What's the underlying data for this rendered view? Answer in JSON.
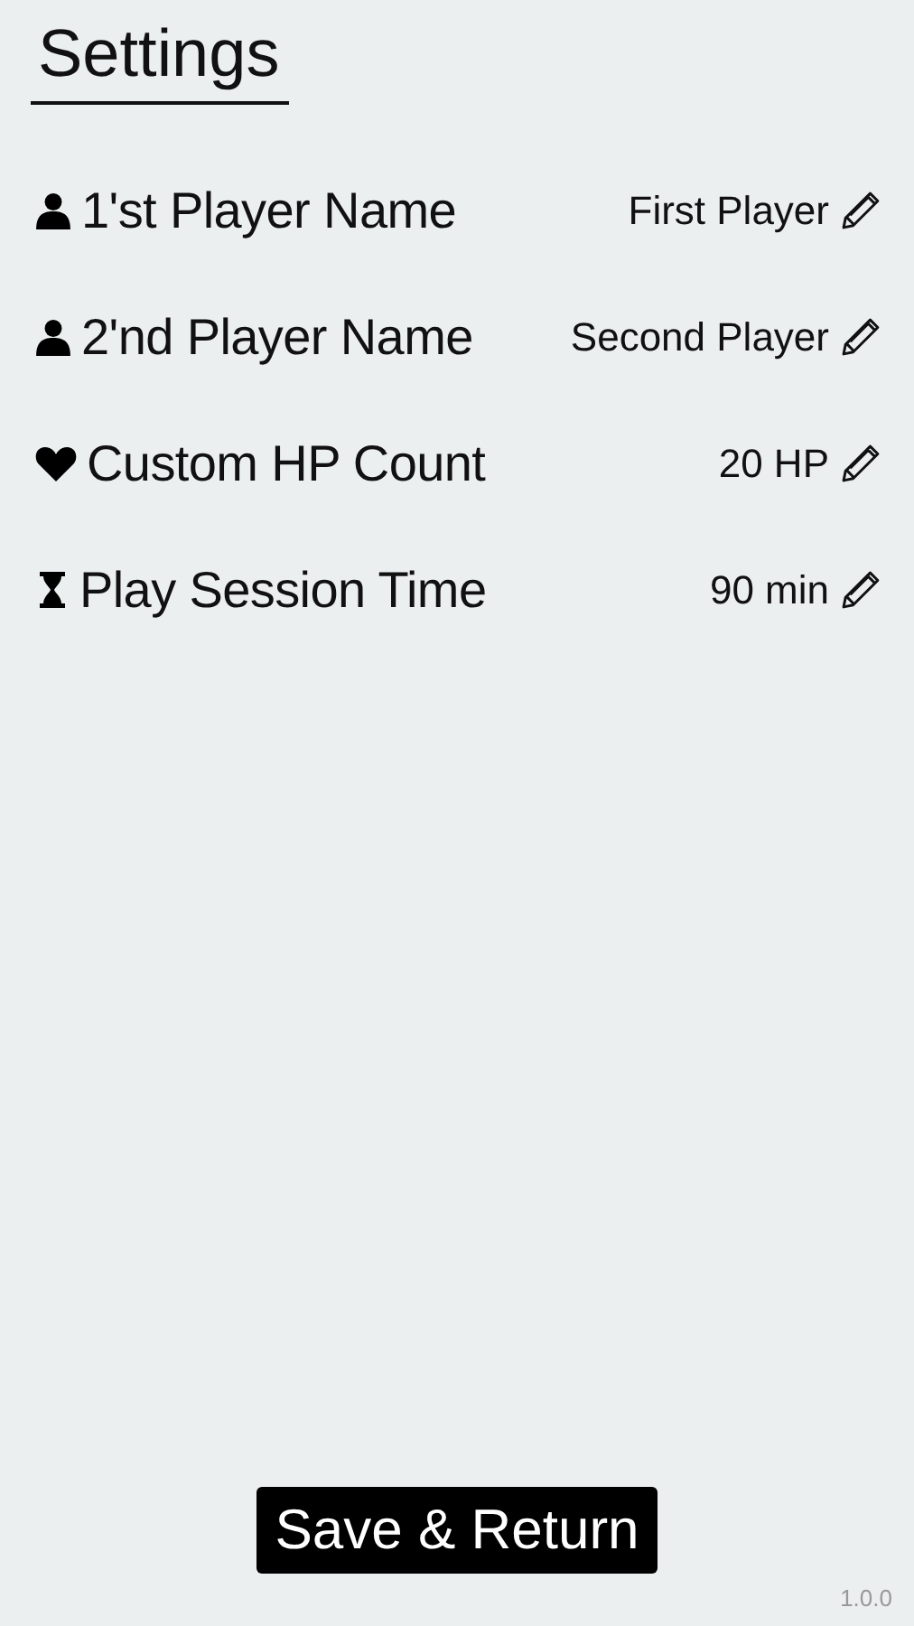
{
  "title": "Settings",
  "settings": [
    {
      "kind": "person",
      "label": "1'st Player Name",
      "value": "First Player"
    },
    {
      "kind": "person",
      "label": "2'nd Player Name",
      "value": "Second Player"
    },
    {
      "kind": "heart",
      "label": "Custom HP Count",
      "value": "20 HP"
    },
    {
      "kind": "hourglass",
      "label": "Play Session Time",
      "value": "90 min"
    }
  ],
  "button": "Save & Return",
  "version": "1.0.0"
}
